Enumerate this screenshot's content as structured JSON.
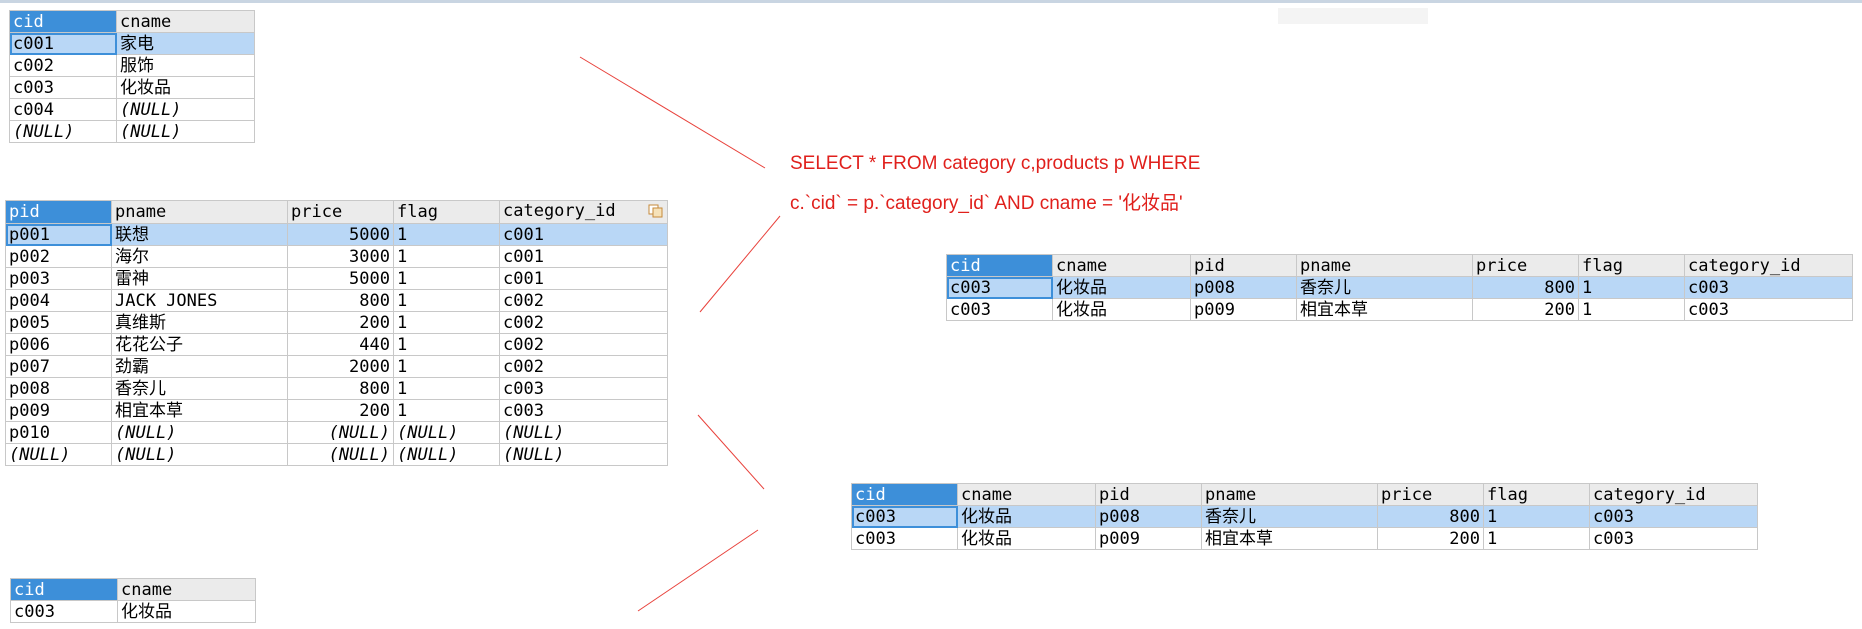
{
  "category_table": {
    "columns": [
      "cid",
      "cname"
    ],
    "rows": [
      [
        "c001",
        "家电"
      ],
      [
        "c002",
        "服饰"
      ],
      [
        "c003",
        "化妆品"
      ],
      [
        "c004",
        "(NULL)"
      ],
      [
        "(NULL)",
        "(NULL)"
      ]
    ]
  },
  "products_table": {
    "columns": [
      "pid",
      "pname",
      "price",
      "flag",
      "category_id"
    ],
    "rows": [
      [
        "p001",
        "联想",
        "5000",
        "1",
        "c001"
      ],
      [
        "p002",
        "海尔",
        "3000",
        "1",
        "c001"
      ],
      [
        "p003",
        "雷神",
        "5000",
        "1",
        "c001"
      ],
      [
        "p004",
        "JACK JONES",
        "800",
        "1",
        "c002"
      ],
      [
        "p005",
        "真维斯",
        "200",
        "1",
        "c002"
      ],
      [
        "p006",
        "花花公子",
        "440",
        "1",
        "c002"
      ],
      [
        "p007",
        "劲霸",
        "2000",
        "1",
        "c002"
      ],
      [
        "p008",
        "香奈儿",
        "800",
        "1",
        "c003"
      ],
      [
        "p009",
        "相宜本草",
        "200",
        "1",
        "c003"
      ],
      [
        "p010",
        "(NULL)",
        "(NULL)",
        "(NULL)",
        "(NULL)"
      ],
      [
        "(NULL)",
        "(NULL)",
        "(NULL)",
        "(NULL)",
        "(NULL)"
      ]
    ]
  },
  "sql": {
    "line1": "SELECT * FROM category c,products p WHERE",
    "line2": "c.`cid` = p.`category_id` AND cname = '化妆品'"
  },
  "result_table_a": {
    "columns": [
      "cid",
      "cname",
      "pid",
      "pname",
      "price",
      "flag",
      "category_id"
    ],
    "rows": [
      [
        "c003",
        "化妆品",
        "p008",
        "香奈儿",
        "800",
        "1",
        "c003"
      ],
      [
        "c003",
        "化妆品",
        "p009",
        "相宜本草",
        "200",
        "1",
        "c003"
      ]
    ]
  },
  "result_table_b": {
    "columns": [
      "cid",
      "cname",
      "pid",
      "pname",
      "price",
      "flag",
      "category_id"
    ],
    "rows": [
      [
        "c003",
        "化妆品",
        "p008",
        "香奈儿",
        "800",
        "1",
        "c003"
      ],
      [
        "c003",
        "化妆品",
        "p009",
        "相宜本草",
        "200",
        "1",
        "c003"
      ]
    ]
  },
  "filtered_category_table": {
    "columns": [
      "cid",
      "cname"
    ],
    "rows": [
      [
        "c003",
        "化妆品"
      ]
    ]
  },
  "colors": {
    "selected_header": "#3d8fd9",
    "current_row": "#b9d7f6",
    "annotation_red": "#e0201c"
  }
}
